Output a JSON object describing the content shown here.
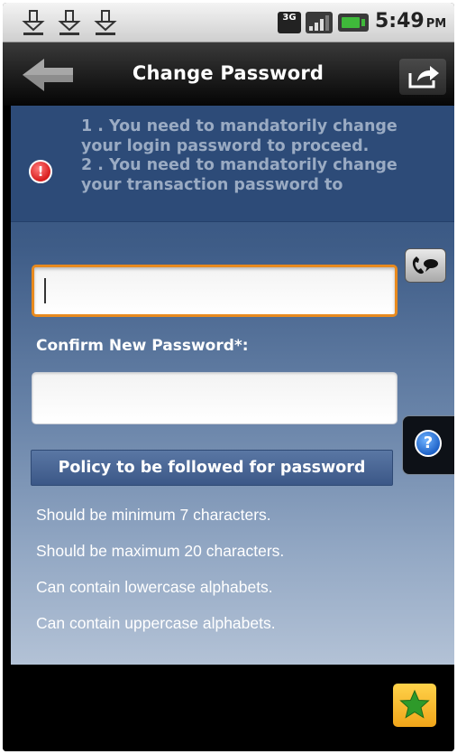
{
  "status_bar": {
    "network_label": "3G",
    "time": "5:49",
    "ampm": "PM"
  },
  "header": {
    "title": "Change Password"
  },
  "notice": {
    "lines": [
      "1 . You need to mandatorily change",
      "your login password to proceed.",
      "2 . You need to mandatorily change",
      "your transaction password to"
    ]
  },
  "form": {
    "new_password_value": "",
    "confirm_label": "Confirm New Password*:",
    "confirm_value": ""
  },
  "policy": {
    "header": "Policy to be followed for password",
    "rules": [
      "Should be minimum 7 characters.",
      "Should be maximum 20 characters.",
      "Can contain lowercase alphabets.",
      "Can contain uppercase alphabets."
    ]
  },
  "colors": {
    "accent_orange": "#e88a1e",
    "panel_blue": "#2d4b78",
    "notice_text": "#9aabc3",
    "favorite_yellow": "#f5b82b",
    "favorite_star": "#2e9a2a"
  },
  "icons": {
    "download_notifications": [
      "download-icon",
      "download-icon",
      "download-icon"
    ],
    "status": [
      "3g-icon",
      "signal-icon",
      "battery-icon"
    ],
    "toolbar": [
      "back-arrow-icon",
      "share-icon"
    ],
    "side": [
      "contact-icon",
      "help-icon"
    ],
    "alert": "alert-icon",
    "footer": "star-icon"
  }
}
